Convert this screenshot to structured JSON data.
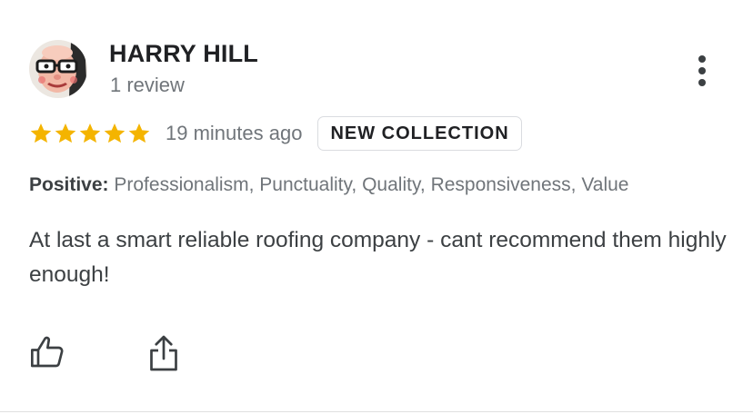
{
  "reviewer": {
    "name": "HARRY HILL",
    "review_count": "1 review",
    "avatar_icon": "cartoon-face-with-glasses"
  },
  "rating": {
    "stars": 5,
    "max_stars": 5,
    "star_color": "#f4b400"
  },
  "time_ago": "19 minutes ago",
  "badge": "NEW COLLECTION",
  "attributes": {
    "label": "Positive:",
    "values": "Professionalism, Punctuality, Quality, Responsiveness, Value"
  },
  "review_text": "At last a smart reliable roofing company - cant recommend them highly enough!",
  "actions": {
    "like_icon": "thumbs-up-icon",
    "share_icon": "share-icon",
    "more_icon": "more-vert-icon"
  }
}
